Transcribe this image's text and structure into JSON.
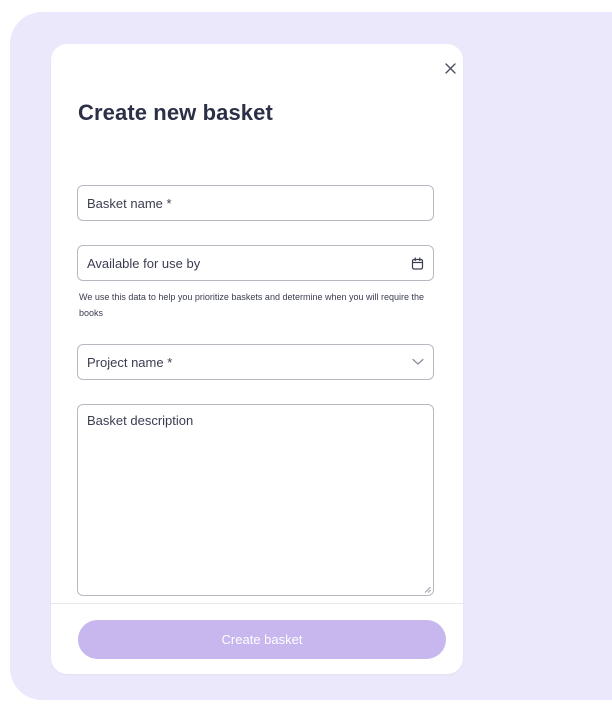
{
  "modal": {
    "title": "Create new basket",
    "close_icon": "close-icon"
  },
  "form": {
    "basket_name": {
      "placeholder": "Basket name *"
    },
    "available_by": {
      "placeholder": "Available for use by",
      "icon": "calendar-icon",
      "helper": "We use this data to help you prioritize baskets and determine when you will require the books"
    },
    "project_name": {
      "placeholder": "Project name *",
      "icon": "chevron-down-icon"
    },
    "description": {
      "placeholder": "Basket description"
    }
  },
  "footer": {
    "create_label": "Create basket"
  },
  "colors": {
    "backdrop": "#ebe8fb",
    "primary_button": "#c8b6ef",
    "title_text": "#2c3047"
  }
}
